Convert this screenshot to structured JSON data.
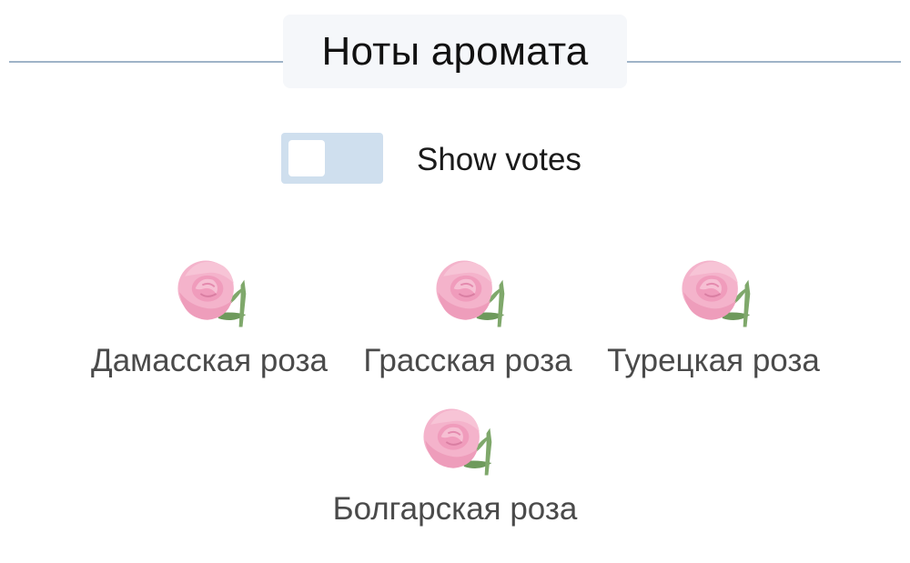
{
  "header": {
    "title": "Ноты аромата"
  },
  "votes_toggle": {
    "label": "Show votes",
    "on": false
  },
  "notes": [
    {
      "name": "Дамасская роза",
      "icon": "rose-icon"
    },
    {
      "name": "Грасская роза",
      "icon": "rose-icon"
    },
    {
      "name": "Турецкая роза",
      "icon": "rose-icon"
    },
    {
      "name": "Болгарская роза",
      "icon": "rose-icon"
    }
  ],
  "colors": {
    "rule": "#9fb3c8",
    "toggle_track": "#cfdfee",
    "title_bg": "#f5f7fa",
    "rose_petal": "#f2a7c3",
    "rose_leaf": "#7fa86b"
  }
}
